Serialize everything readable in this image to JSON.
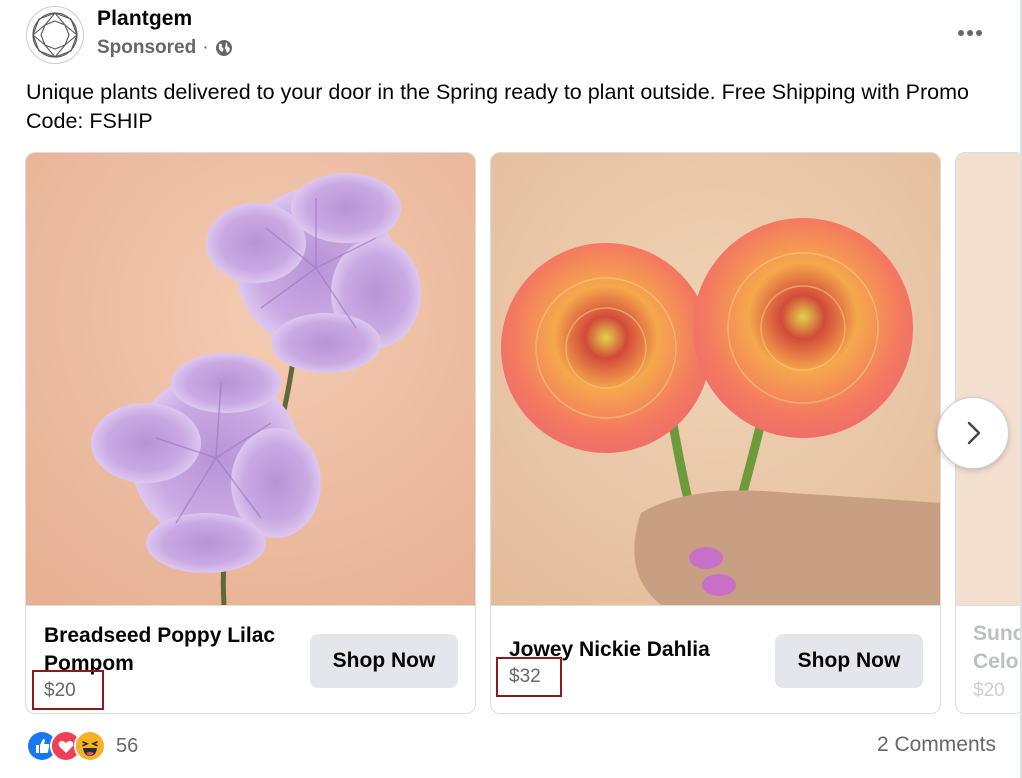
{
  "post": {
    "page_name": "Plantgem",
    "sponsored_label": "Sponsored",
    "separator": "·",
    "privacy_icon": "globe-icon",
    "menu_icon": "more-options-icon",
    "text": "Unique plants delivered to your door in the Spring ready to plant outside. Free Shipping with Promo Code: FSHIP"
  },
  "carousel": {
    "cards": [
      {
        "title": "Breadseed Poppy Lilac Pompom",
        "price": "$20",
        "cta": "Shop Now"
      },
      {
        "title": "Jowey Nickie Dahlia",
        "price": "$32",
        "cta": "Shop Now"
      },
      {
        "title": "Sunc\nCelo",
        "price": "$20"
      }
    ],
    "next_icon": "chevron-right-icon"
  },
  "footer": {
    "reaction_icons": [
      "like-icon",
      "love-icon",
      "haha-icon"
    ],
    "reaction_count": "56",
    "comments": "2 Comments"
  },
  "colors": {
    "secondary_text": "#65676b",
    "button_bg": "#e4e6eb",
    "price_highlight": "#8b1a1a",
    "like_blue": "#1877f2",
    "love_red": "#f33e58",
    "haha_yellow": "#f7b125"
  }
}
